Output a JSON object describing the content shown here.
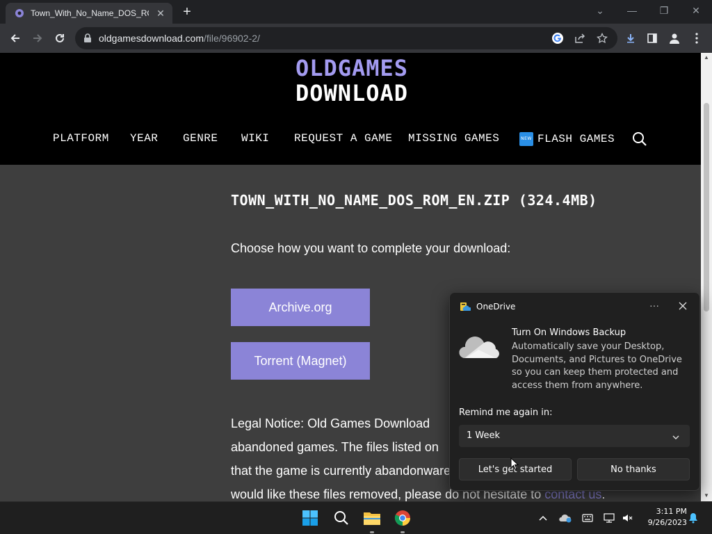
{
  "browser": {
    "tab_title": "Town_With_No_Name_DOS_ROM_EN",
    "url_domain": "oldgamesdownload.com",
    "url_path": "/file/96902-2/"
  },
  "site": {
    "logo_line1": "OLDGAMES",
    "logo_line2": "DOWNLOAD",
    "nav": {
      "platform": "PLATFORM",
      "year": "YEAR",
      "genre": "GENRE",
      "wiki": "WIKI",
      "request": "REQUEST A GAME",
      "missing": "MISSING GAMES",
      "flash_badge": "NEW",
      "flash": "FLASH GAMES"
    }
  },
  "main": {
    "file_title": "TOWN_WITH_NO_NAME_DOS_ROM_EN.ZIP (324.4MB)",
    "choose_text": "Choose how you want to complete your download:",
    "btn_archive": "Archive.org",
    "btn_torrent": "Torrent (Magnet)",
    "legal": {
      "line1": "Legal Notice: Old Games Download",
      "line2": "abandoned games. The files listed on",
      "line3": "that the game is currently abandonware",
      "line4_pre": "would like these files removed, please do not hesitate to",
      "link": "contact us",
      "line4_post": "."
    }
  },
  "onedrive": {
    "title": "OneDrive",
    "more": "···",
    "heading": "Turn On Windows Backup",
    "body": "Automatically save your Desktop, Documents, and Pictures to OneDrive so you can keep them protected and access them from anywhere.",
    "remind_label": "Remind me again in:",
    "remind_value": "1 Week",
    "btn_start": "Let's get started",
    "btn_no": "No thanks"
  },
  "taskbar": {
    "time": "3:11 PM",
    "date": "9/26/2023"
  },
  "colors": {
    "accent_purple": "#8b84d7",
    "logo_purple": "#a39bf0",
    "page_bg": "#3e3e3e",
    "header_bg": "#000000"
  }
}
